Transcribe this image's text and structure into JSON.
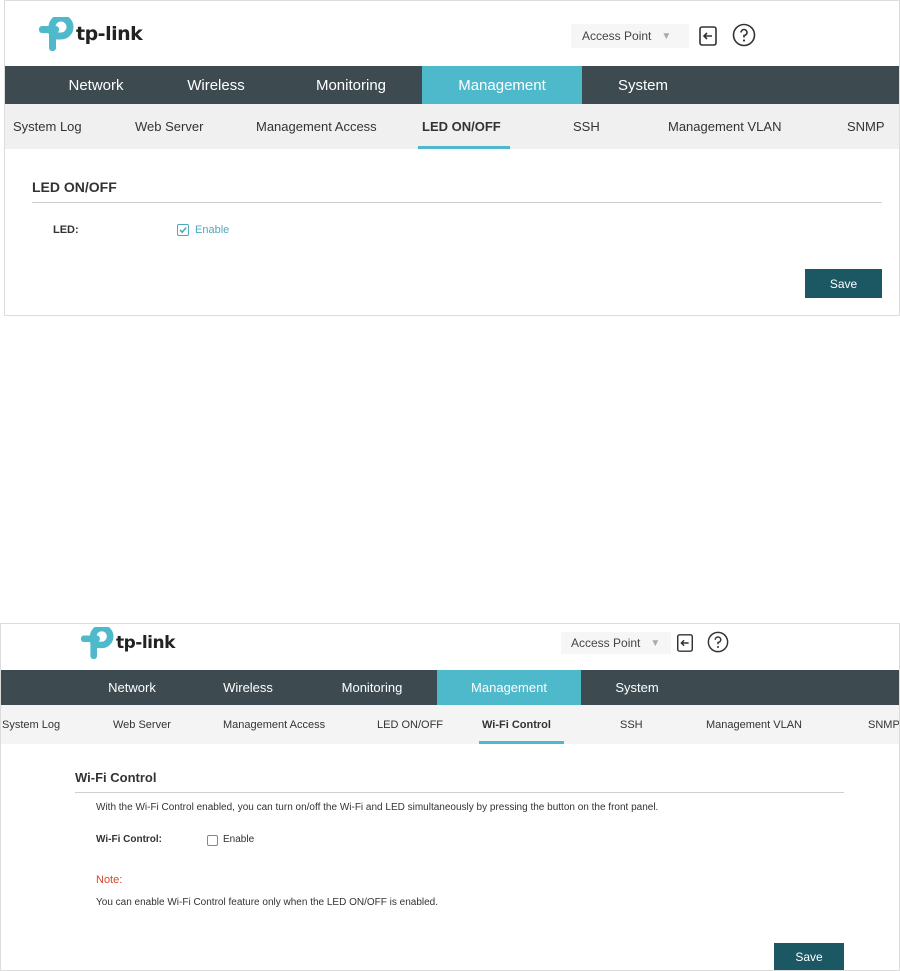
{
  "brand": {
    "logo_text": "tp-link",
    "logo_icon": "tp-link-logo-icon",
    "brand_color": "#4fb9cc"
  },
  "colors": {
    "nav_bg": "#3d4b50",
    "nav_active": "#4fb9cc",
    "subnav_bg": "#f0f0f0",
    "save_button": "#1c5864",
    "note": "#d8452c"
  },
  "screen1": {
    "header": {
      "mode": "Access Point",
      "logout_icon": "logout-icon",
      "help_icon": "help-icon"
    },
    "main_nav": [
      {
        "label": "Network"
      },
      {
        "label": "Wireless"
      },
      {
        "label": "Monitoring"
      },
      {
        "label": "Management",
        "active": true
      },
      {
        "label": "System"
      }
    ],
    "sub_nav": [
      {
        "label": "System Log"
      },
      {
        "label": "Web Server"
      },
      {
        "label": "Management Access"
      },
      {
        "label": "LED ON/OFF",
        "active": true
      },
      {
        "label": "SSH"
      },
      {
        "label": "Management VLAN"
      },
      {
        "label": "SNMP"
      }
    ],
    "section": {
      "title": "LED ON/OFF",
      "field_label": "LED:",
      "checkbox_label": "Enable",
      "checked": true,
      "save_label": "Save"
    }
  },
  "screen2": {
    "header": {
      "mode": "Access Point",
      "logout_icon": "logout-icon",
      "help_icon": "help-icon"
    },
    "main_nav": [
      {
        "label": "Network"
      },
      {
        "label": "Wireless"
      },
      {
        "label": "Monitoring"
      },
      {
        "label": "Management",
        "active": true
      },
      {
        "label": "System"
      }
    ],
    "sub_nav": [
      {
        "label": "System Log"
      },
      {
        "label": "Web Server"
      },
      {
        "label": "Management Access"
      },
      {
        "label": "LED ON/OFF"
      },
      {
        "label": "Wi-Fi Control",
        "active": true
      },
      {
        "label": "SSH"
      },
      {
        "label": "Management VLAN"
      },
      {
        "label": "SNMP"
      }
    ],
    "section": {
      "title": "Wi-Fi Control",
      "description": "With the Wi-Fi Control enabled, you can turn on/off the Wi-Fi and LED simultaneously by pressing the button on the front panel.",
      "field_label": "Wi-Fi Control:",
      "checkbox_label": "Enable",
      "checked": false,
      "note_label": "Note:",
      "note_text": "You can enable Wi-Fi Control feature only when the LED ON/OFF is enabled.",
      "save_label": "Save"
    }
  }
}
